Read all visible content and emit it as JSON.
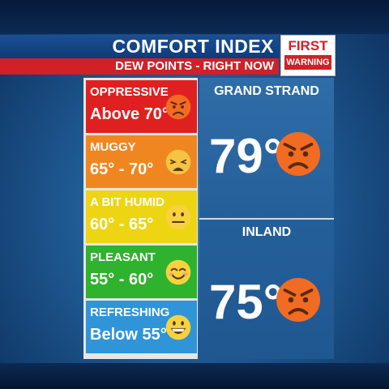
{
  "header": {
    "title": "COMFORT INDEX",
    "subtitle": "DEW POINTS - RIGHT NOW",
    "logo_top": "FIRST",
    "logo_bottom": "WARNING"
  },
  "legend": [
    {
      "name": "OPPRESSIVE",
      "range": "Above 70°",
      "color": "#e02020",
      "icon": "angry-face-icon"
    },
    {
      "name": "MUGGY",
      "range": "65° - 70°",
      "color": "#f0861f",
      "icon": "weary-face-icon"
    },
    {
      "name": "A BIT HUMID",
      "range": "60° - 65°",
      "color": "#eed513",
      "icon": "neutral-face-icon"
    },
    {
      "name": "PLEASANT",
      "range": "55° - 60°",
      "color": "#2fb22d",
      "icon": "smiling-face-icon"
    },
    {
      "name": "REFRESHING",
      "range": "Below 55°",
      "color": "#2f95d8",
      "icon": "grinning-face-icon"
    }
  ],
  "locations": [
    {
      "name": "GRAND STRAND",
      "temp": "79°",
      "icon": "angry-face-icon"
    },
    {
      "name": "INLAND",
      "temp": "75°",
      "icon": "angry-face-icon"
    }
  ],
  "colors": {
    "accent_red": "#d22027",
    "header_blue": "#0f3b78"
  }
}
